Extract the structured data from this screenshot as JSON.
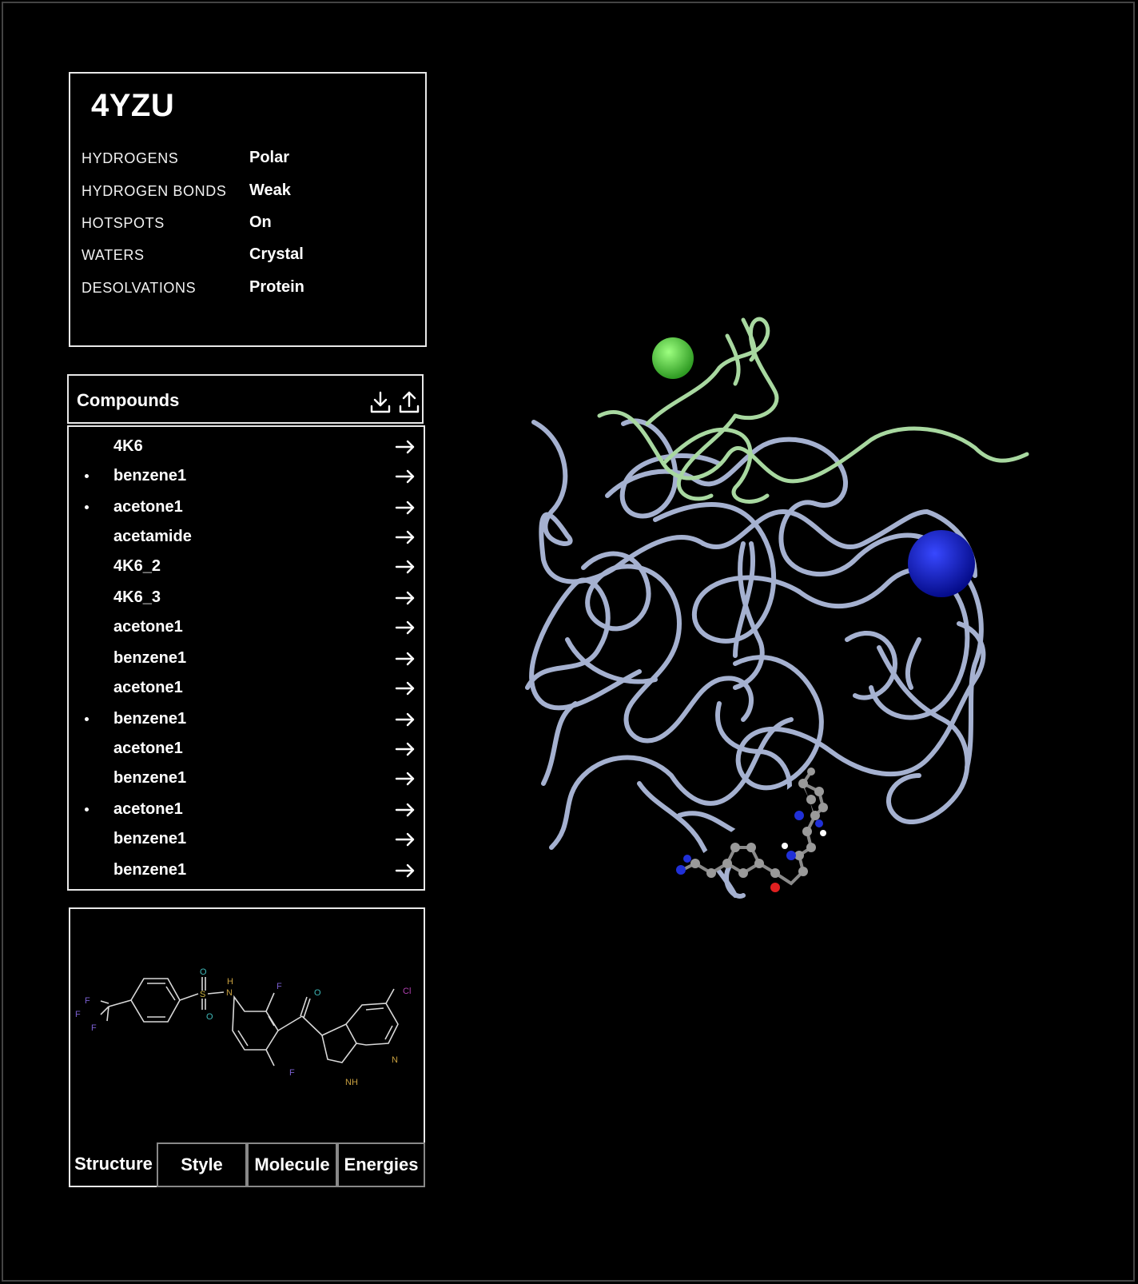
{
  "info": {
    "title": "4YZU",
    "rows": [
      {
        "label": "HYDROGENS",
        "value": "Polar"
      },
      {
        "label": "HYDROGEN BONDS",
        "value": "Weak"
      },
      {
        "label": "HOTSPOTS",
        "value": "On"
      },
      {
        "label": "WATERS",
        "value": "Crystal"
      },
      {
        "label": "DESOLVATIONS",
        "value": "Protein"
      }
    ]
  },
  "compounds": {
    "title": "Compounds",
    "icons": [
      "download-icon",
      "upload-icon"
    ],
    "items": [
      {
        "name": "4K6",
        "bullet": false
      },
      {
        "name": "benzene1",
        "bullet": true
      },
      {
        "name": "acetone1",
        "bullet": true
      },
      {
        "name": "acetamide",
        "bullet": false
      },
      {
        "name": "4K6_2",
        "bullet": false
      },
      {
        "name": "4K6_3",
        "bullet": false
      },
      {
        "name": "acetone1",
        "bullet": false
      },
      {
        "name": "benzene1",
        "bullet": false
      },
      {
        "name": "acetone1",
        "bullet": false
      },
      {
        "name": "benzene1",
        "bullet": true
      },
      {
        "name": "acetone1",
        "bullet": false
      },
      {
        "name": "benzene1",
        "bullet": false
      },
      {
        "name": "acetone1",
        "bullet": true
      },
      {
        "name": "benzene1",
        "bullet": false
      },
      {
        "name": "benzene1",
        "bullet": false
      }
    ]
  },
  "structure": {
    "atom_labels": {
      "f1": "F",
      "f2": "F",
      "f3": "F",
      "s": "S",
      "o1": "O",
      "o2": "O",
      "nh": "H",
      "n_amine": "N",
      "f4": "F",
      "f5": "F",
      "o3": "O",
      "cl": "Cl",
      "n_pyr": "N",
      "nh2": "NH"
    },
    "colors": {
      "F": "#7a5fd0",
      "S": "#c8b040",
      "O": "#3fb8b8",
      "N": "#c8a040",
      "Cl": "#b040b0",
      "bond": "#d8d8d8"
    }
  },
  "tabs": [
    {
      "label": "Structure",
      "active": true
    },
    {
      "label": "Style",
      "active": false
    },
    {
      "label": "Molecule",
      "active": false
    },
    {
      "label": "Energies",
      "active": false
    }
  ],
  "viewer": {
    "colors": {
      "protein": "#aebbdc",
      "peptide": "#a8d8a0",
      "green_sphere": "#5fdc4a",
      "blue_sphere": "#1020d8",
      "ligand": "#9a9a9a"
    }
  }
}
